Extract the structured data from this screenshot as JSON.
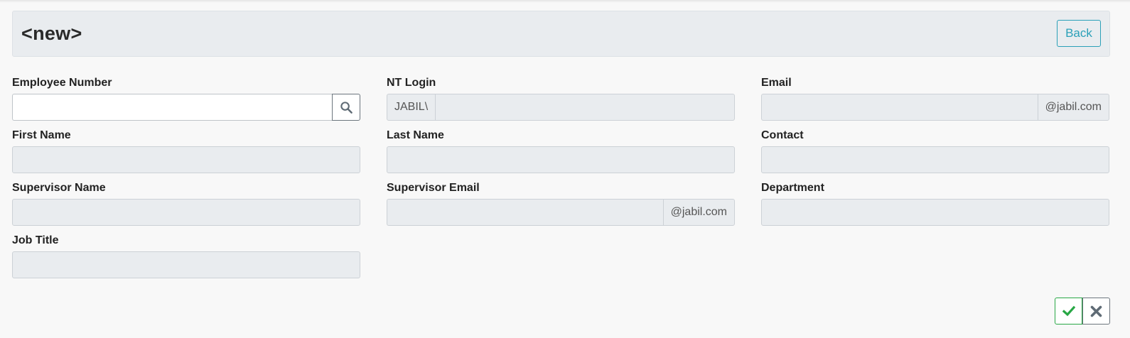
{
  "header": {
    "title": "<new>",
    "back_label": "Back"
  },
  "fields": {
    "employee_number": {
      "label": "Employee Number",
      "value": "",
      "placeholder": ""
    },
    "nt_login": {
      "label": "NT Login",
      "prefix": "JABIL\\",
      "value": ""
    },
    "email": {
      "label": "Email",
      "suffix": "@jabil.com",
      "value": ""
    },
    "first_name": {
      "label": "First Name",
      "value": ""
    },
    "last_name": {
      "label": "Last Name",
      "value": ""
    },
    "contact": {
      "label": "Contact",
      "value": ""
    },
    "supervisor_name": {
      "label": "Supervisor Name",
      "value": ""
    },
    "supervisor_email": {
      "label": "Supervisor Email",
      "suffix": "@jabil.com",
      "value": ""
    },
    "department": {
      "label": "Department",
      "value": ""
    },
    "job_title": {
      "label": "Job Title",
      "value": ""
    }
  },
  "icons": {
    "search": "search-icon",
    "confirm": "check-icon",
    "cancel": "close-icon"
  },
  "colors": {
    "accent": "#2aa0b8",
    "confirm": "#28a745",
    "cancel": "#6c757d",
    "readonly_bg": "#e9ecef",
    "page_bg": "#f8f8f8"
  }
}
